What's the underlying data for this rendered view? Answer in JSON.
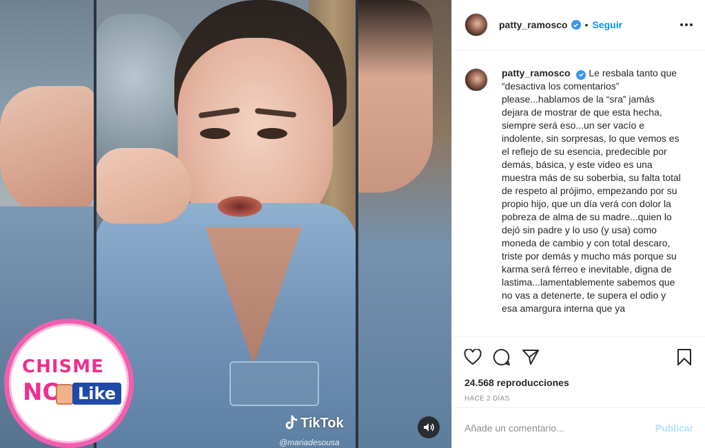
{
  "media": {
    "tiktok_logo_text": "TikTok",
    "tiktok_handle": "@mariadesousa",
    "brand_badge": {
      "top": "CHISME",
      "no": "NO",
      "like": "Like"
    }
  },
  "post": {
    "username": "patty_ramosco",
    "separator": "•",
    "follow_label": "Seguir",
    "caption": "Le resbala tanto que “desactiva los comentarios” please...hablamos de la “sra” jamás dejara de mostrar de que esta hecha, siempre será eso...un ser vacío e indolente, sin sorpresas, lo que vemos es el reflejo de su esencia, predecible por demás, básica, y este video es una muestra más de su soberbia, su falta total de respeto al prójimo, empezando por su propio hijo, que un día verá con dolor la pobreza de alma de su madre...quien lo dejó sin padre y lo uso (y usa) como moneda de cambio y con total descaro, triste por demás y mucho más porque su karma será férreo e inevitable, digna de lastima...lamentablemente sabemos que no vas a detenerte, te supera el odio y esa amargura interna que ya",
    "views": "24.568 reproducciones",
    "time_ago": "HACE 2 DÍAS"
  },
  "comment": {
    "placeholder": "Añade un comentario...",
    "publish_label": "Publicar"
  },
  "colors": {
    "accent_blue": "#0095f6",
    "verified_blue": "#3897f0",
    "publish_disabled": "#b2dffc",
    "badge_pink": "#ee2f8f",
    "badge_blue": "#1f4aa8"
  },
  "icons": [
    "heart-icon",
    "comment-icon",
    "share-icon",
    "bookmark-icon",
    "volume-icon",
    "verified-icon",
    "more-options-icon",
    "tiktok-icon",
    "thumbs-down-icon"
  ]
}
